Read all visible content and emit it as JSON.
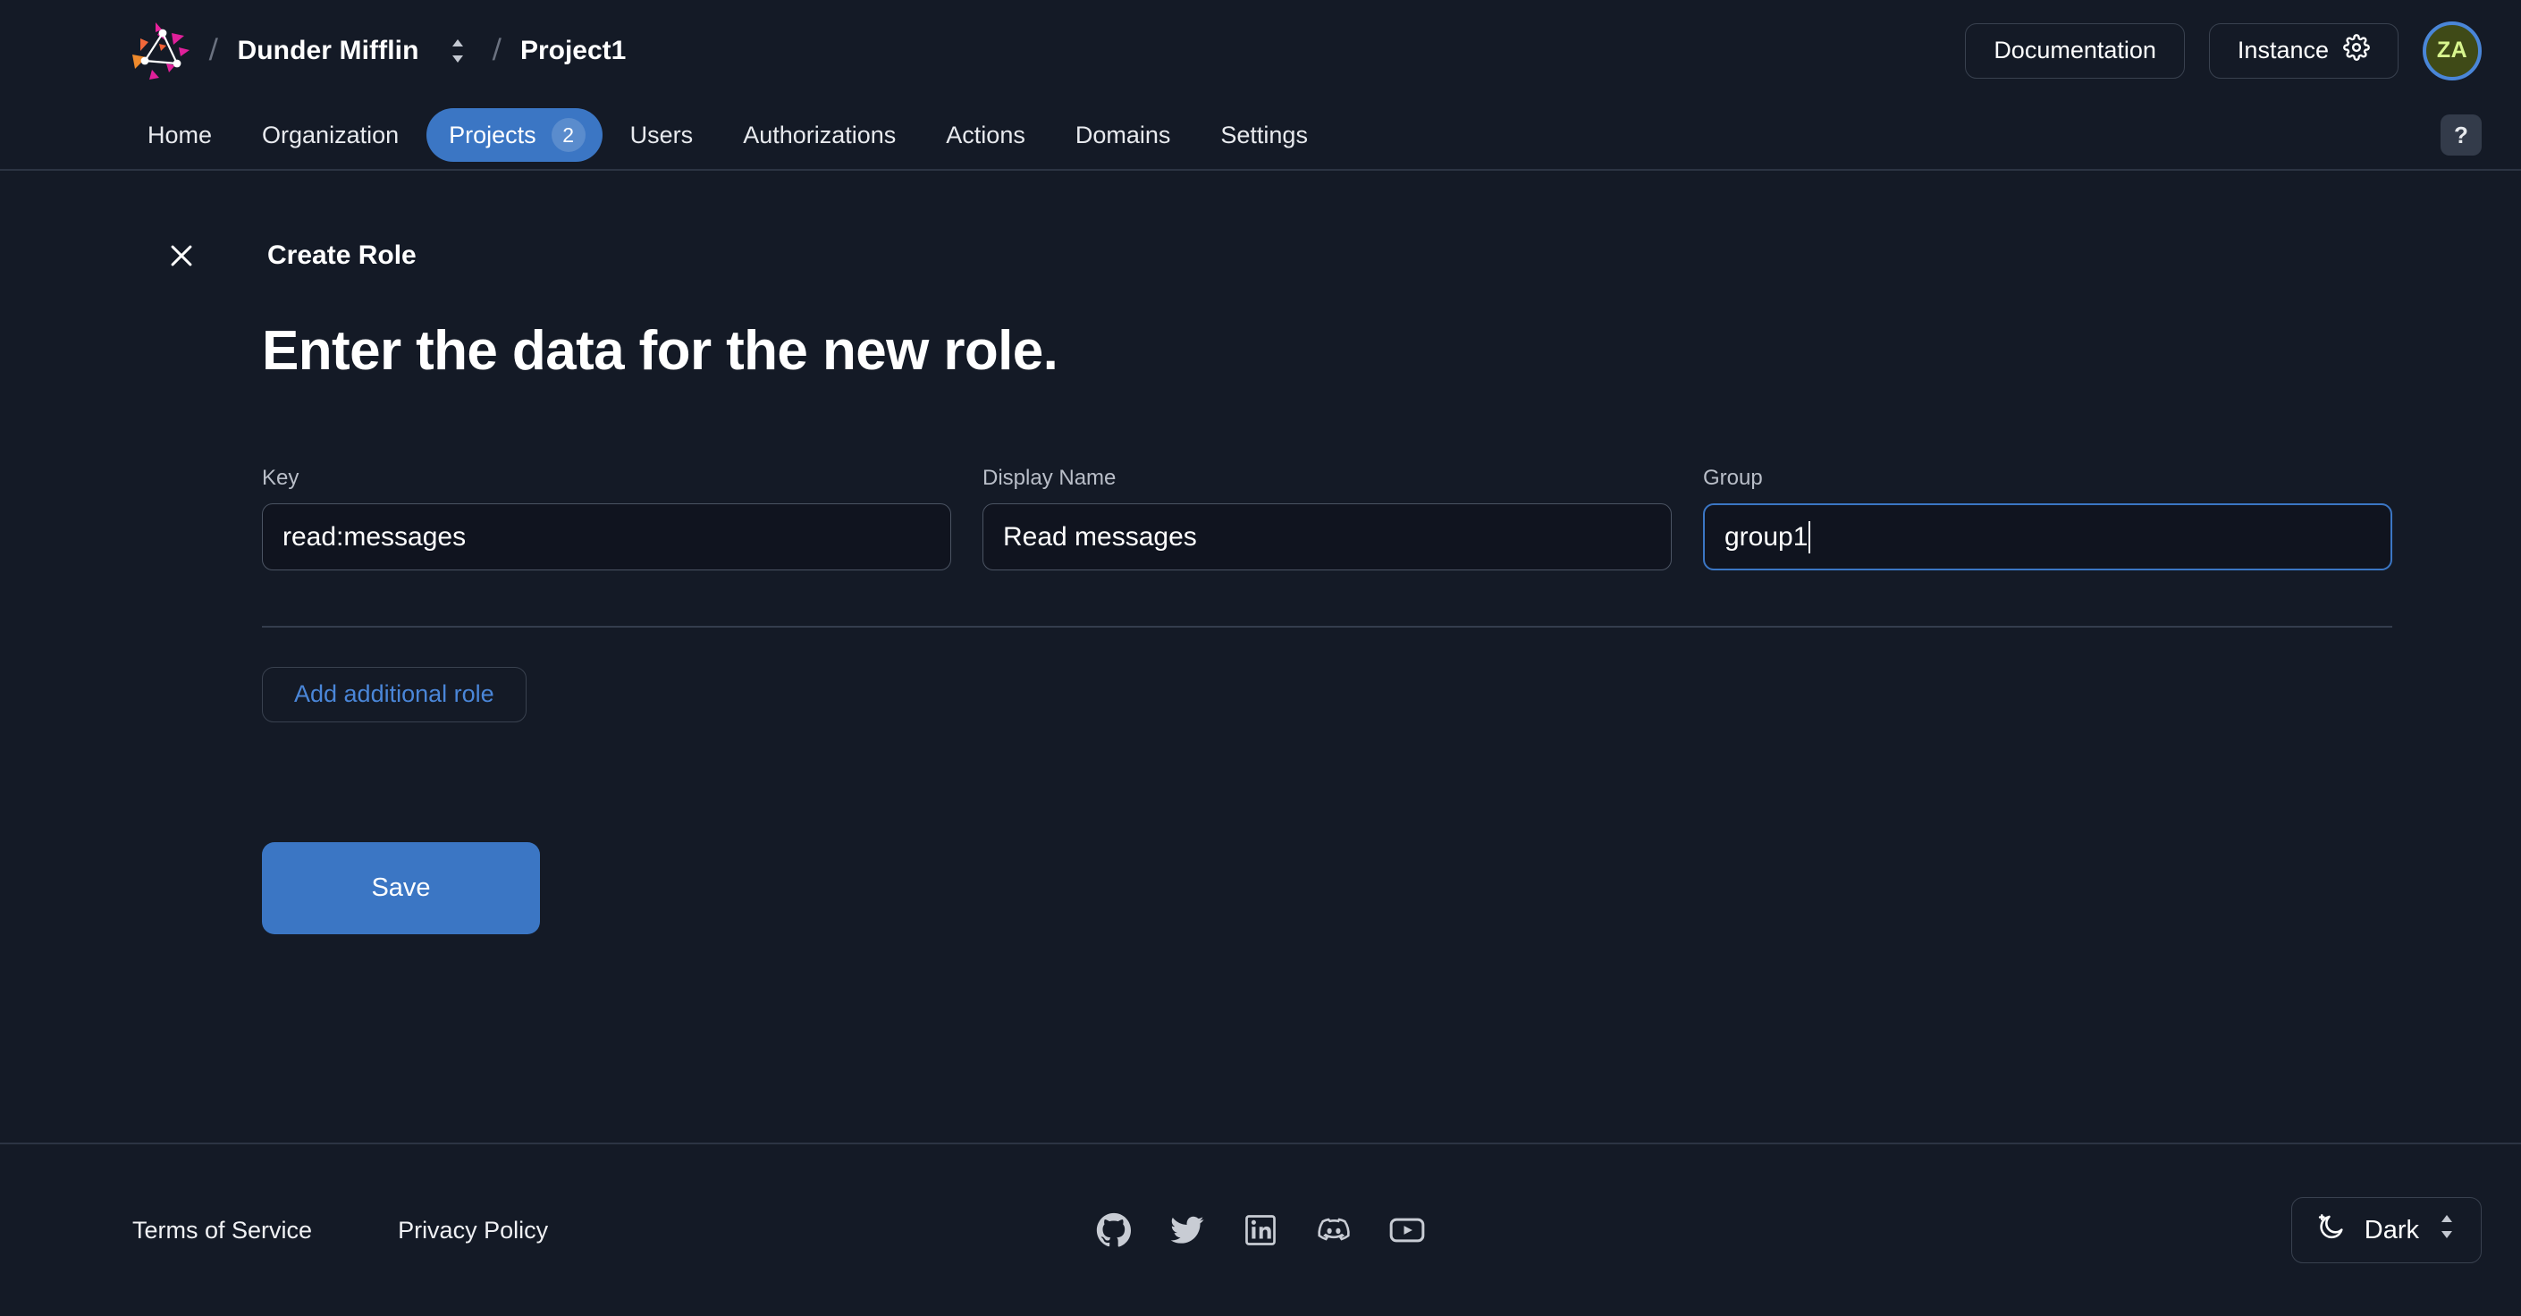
{
  "header": {
    "logo_icon": "triangle-network-logo",
    "org_name": "Dunder Mifflin",
    "org_switcher_icon": "chevron-up-down-icon",
    "separator": "/",
    "project_name": "Project1",
    "documentation_label": "Documentation",
    "instance_label": "Instance",
    "instance_icon": "gear-icon",
    "avatar_initials": "ZA",
    "avatar_bg": "#3f4a17",
    "avatar_text_color": "#d8f58e",
    "avatar_ring_color": "#4a86d8"
  },
  "nav": {
    "items": [
      {
        "label": "Home",
        "active": false,
        "badge": ""
      },
      {
        "label": "Organization",
        "active": false,
        "badge": ""
      },
      {
        "label": "Projects",
        "active": true,
        "badge": "2"
      },
      {
        "label": "Users",
        "active": false,
        "badge": ""
      },
      {
        "label": "Authorizations",
        "active": false,
        "badge": ""
      },
      {
        "label": "Actions",
        "active": false,
        "badge": ""
      },
      {
        "label": "Domains",
        "active": false,
        "badge": ""
      },
      {
        "label": "Settings",
        "active": false,
        "badge": ""
      }
    ],
    "help_label": "?",
    "active_color": "#3b76c4"
  },
  "modal": {
    "close_icon": "close-x-icon",
    "title": "Create Role",
    "heading": "Enter the data for the new role.",
    "fields": [
      {
        "label": "Key",
        "value": "read:messages",
        "placeholder": "",
        "focused": false
      },
      {
        "label": "Display Name",
        "value": "Read messages",
        "placeholder": "",
        "focused": false
      },
      {
        "label": "Group",
        "value": "group1",
        "placeholder": "",
        "focused": true
      }
    ],
    "add_role_label": "Add additional role",
    "add_role_color": "#4a86d8",
    "save_label": "Save",
    "save_color": "#3b76c4"
  },
  "footer": {
    "terms_label": "Terms of Service",
    "privacy_label": "Privacy Policy",
    "social": [
      "github-icon",
      "twitter-icon",
      "linkedin-icon",
      "discord-icon",
      "youtube-icon"
    ],
    "theme_icon": "moon-sparkle-icon",
    "theme_label": "Dark",
    "theme_switcher_icon": "chevron-up-down-icon"
  }
}
